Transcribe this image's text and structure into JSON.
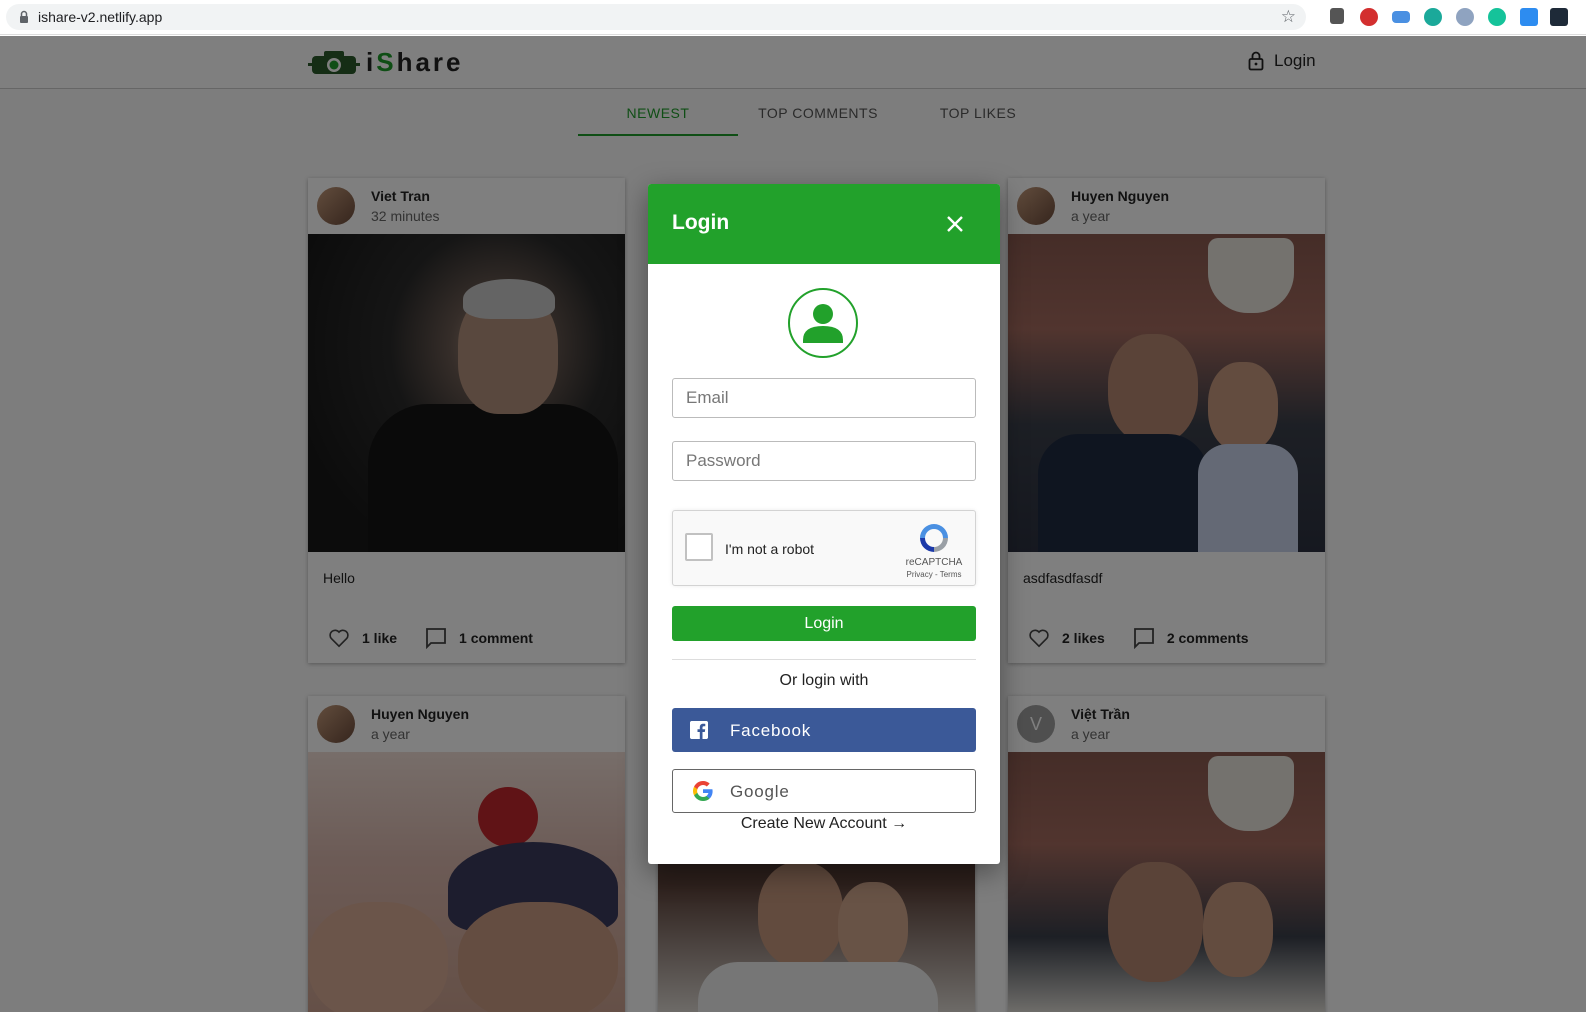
{
  "browser": {
    "url": "ishare-v2.netlify.app"
  },
  "header": {
    "logo_prefix": "i",
    "logo_accent": "S",
    "logo_suffix": "hare",
    "login_label": "Login"
  },
  "tabs": [
    {
      "label": "NEWEST"
    },
    {
      "label": "TOP COMMENTS"
    },
    {
      "label": "TOP LIKES"
    }
  ],
  "posts": [
    {
      "author": "Viet Tran",
      "time": "32 minutes",
      "caption": "Hello",
      "likes": "1 like",
      "comments": "1 comment"
    },
    {
      "author": "Huyen Nguyen",
      "time": "a year",
      "caption": "asdfasdfasdf",
      "likes": "2 likes",
      "comments": "2 comments"
    },
    {
      "author": "Huyen Nguyen",
      "time": "a year"
    },
    {
      "author": "Việt Trần",
      "time": "a year",
      "avatar_letter": "V"
    }
  ],
  "modal": {
    "title": "Login",
    "email_placeholder": "Email",
    "password_placeholder": "Password",
    "recaptcha_label": "I'm not a robot",
    "recaptcha_brand": "reCAPTCHA",
    "recaptcha_links": "Privacy - Terms",
    "login_button": "Login",
    "or_text": "Or login with",
    "facebook_label": "Facebook",
    "google_label": "Google",
    "create_account": "Create New Account →"
  },
  "colors": {
    "brand_green": "#22a12b",
    "facebook_blue": "#3b5998"
  },
  "icons": [
    "lock-icon",
    "star-icon",
    "camera-logo-icon",
    "padlock-icon",
    "heart-icon",
    "comment-icon",
    "close-icon",
    "user-icon",
    "recaptcha-icon",
    "facebook-icon",
    "google-icon"
  ]
}
